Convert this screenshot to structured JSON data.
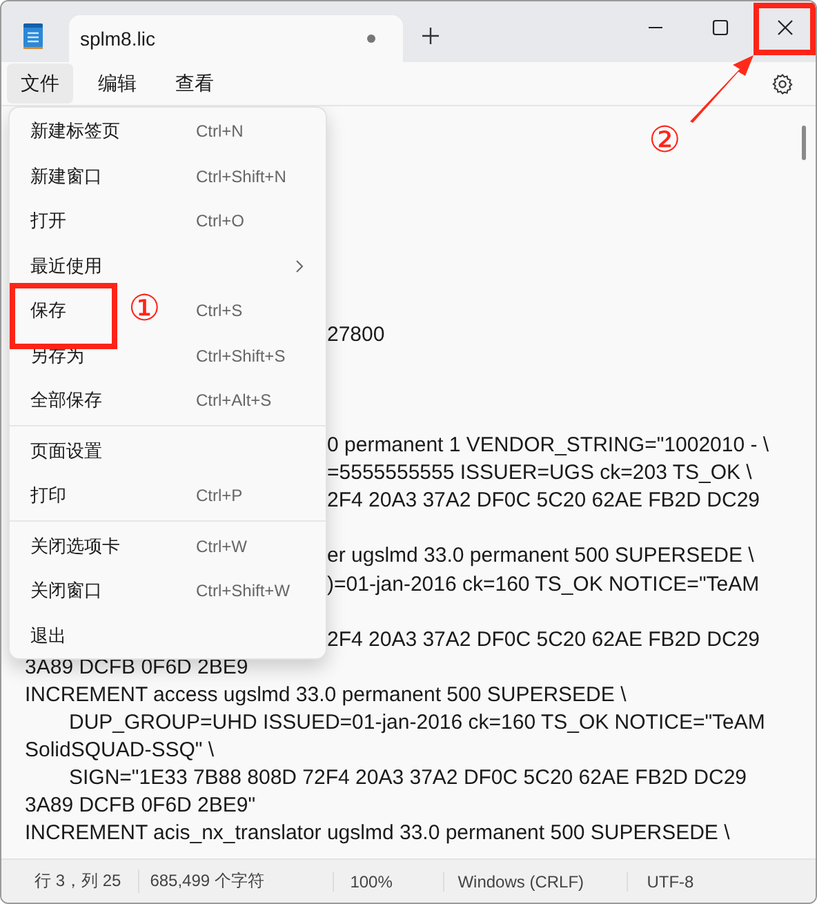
{
  "window": {
    "tabs": [
      {
        "title": "splm8.lic",
        "unsaved": true,
        "selected": true
      }
    ]
  },
  "menu_bar": {
    "items": [
      {
        "label": "文件",
        "selected": true
      },
      {
        "label": "编辑",
        "selected": false
      },
      {
        "label": "查看",
        "selected": false
      }
    ]
  },
  "file_menu": {
    "groups": [
      [
        {
          "label": "新建标签页",
          "shortcut": "Ctrl+N"
        },
        {
          "label": "新建窗口",
          "shortcut": "Ctrl+Shift+N"
        },
        {
          "label": "打开",
          "shortcut": "Ctrl+O"
        },
        {
          "label": "最近使用",
          "submenu": true
        },
        {
          "label": "保存",
          "shortcut": "Ctrl+S",
          "marker": "①"
        },
        {
          "label": "另存为",
          "shortcut": "Ctrl+Shift+S"
        },
        {
          "label": "全部保存",
          "shortcut": "Ctrl+Alt+S"
        }
      ],
      [
        {
          "label": "页面设置"
        },
        {
          "label": "打印",
          "shortcut": "Ctrl+P"
        }
      ],
      [
        {
          "label": "关闭选项卡",
          "shortcut": "Ctrl+W"
        },
        {
          "label": "关闭窗口",
          "shortcut": "Ctrl+Shift+W"
        },
        {
          "label": "退出"
        }
      ]
    ]
  },
  "close_marker": "②",
  "editor": {
    "lines": [
      {
        "kind": "blank"
      },
      {
        "kind": "blank"
      },
      {
        "kind": "blank"
      },
      {
        "kind": "blank"
      },
      {
        "kind": "blank"
      },
      {
        "kind": "blank"
      },
      {
        "kind": "blank"
      },
      {
        "kind": "covered",
        "text": "27800"
      },
      {
        "kind": "blank"
      },
      {
        "kind": "blank"
      },
      {
        "kind": "blank"
      },
      {
        "kind": "covered",
        "text": "0 permanent 1 VENDOR_STRING=\"1002010 - \\"
      },
      {
        "kind": "covered",
        "text": "=5555555555 ISSUER=UGS ck=203 TS_OK \\"
      },
      {
        "kind": "covered",
        "text": "2F4 20A3 37A2 DF0C 5C20 62AE FB2D DC29"
      },
      {
        "kind": "blank"
      },
      {
        "kind": "covered",
        "text": "er ugslmd 33.0 permanent 500 SUPERSEDE \\"
      },
      {
        "kind": "covered",
        "text": ")=01-jan-2016 ck=160 TS_OK NOTICE=\"TeAM"
      },
      {
        "kind": "blank"
      },
      {
        "kind": "covered",
        "text": "2F4 20A3 37A2 DF0C 5C20 62AE FB2D DC29"
      },
      {
        "kind": "plain",
        "text": "3A89 DCFB 0F6D 2BE9"
      },
      {
        "kind": "plain",
        "text": "INCREMENT access ugslmd 33.0 permanent 500 SUPERSEDE \\"
      },
      {
        "kind": "indented",
        "text": "DUP_GROUP=UHD ISSUED=01-jan-2016 ck=160 TS_OK NOTICE=\"TeAM"
      },
      {
        "kind": "plain",
        "text": "SolidSQUAD-SSQ\" \\"
      },
      {
        "kind": "indented",
        "text": "SIGN=\"1E33 7B88 808D 72F4 20A3 37A2 DF0C 5C20 62AE FB2D DC29"
      },
      {
        "kind": "plain",
        "text": "3A89 DCFB 0F6D 2BE9\""
      },
      {
        "kind": "plain",
        "text": "INCREMENT acis_nx_translator ugslmd 33.0 permanent 500 SUPERSEDE \\"
      }
    ]
  },
  "status_bar": [
    "行 3，列 25",
    "685,499 个字符",
    "100%",
    "Windows (CRLF)",
    "UTF-8"
  ]
}
